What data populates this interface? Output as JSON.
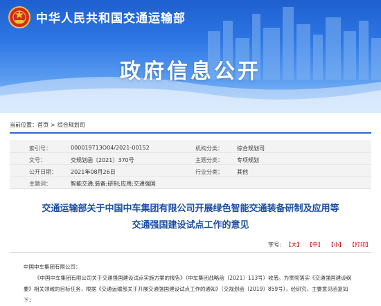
{
  "header": {
    "ministry": "中华人民共和国交通运输部",
    "banner_title": "政府信息公开"
  },
  "breadcrumb": {
    "prefix": "当前位置：",
    "items": [
      "首页",
      "综合规划司"
    ],
    "separator": ">"
  },
  "meta": {
    "index_label": "索引号：",
    "index_value": "000019713O04/2021-00152",
    "org_label": "机构分类：",
    "org_value": "综合规划司",
    "docno_label": "文号：",
    "docno_value": "交规划函〔2021〕370号",
    "theme_label": "主题分类：",
    "theme_value": "专项规划",
    "date_label": "公开日期：",
    "date_value": "2021年08月26日",
    "industry_label": "行业分类：",
    "industry_value": "其他",
    "keyword_label": "主题词：",
    "keyword_value": "智能交通;装备;研制;应用;交通强国"
  },
  "document": {
    "title_line1": "交通运输部关于中国中车集团有限公司开展绿色智能交通装备研制及应用等",
    "title_line2": "交通强国建设试点工作的意见",
    "font_label": "字号:",
    "font_large": "【大】",
    "font_medium": "【中】",
    "font_small": "【小】",
    "print": "【打印】",
    "salutation": "中国中车集团有限公司：",
    "para1": "《中国中车集团有限公司关于交通强国建设试点实施方案的报告》（中车集团战略函〔2021〕113号）收悉。为贯彻落实《交通强国建设纲",
    "para2": "要》相关领域的目标任务，根据《交通运输部关于开展交通强国建设试点工作的通知》（交规划函〔2019〕859号），经研究，主要意见函复如",
    "para3": "下："
  },
  "colors": {
    "banner_top": "#1f5fcf",
    "title_blue": "#1b4ea3",
    "accent_red": "#c00000"
  }
}
